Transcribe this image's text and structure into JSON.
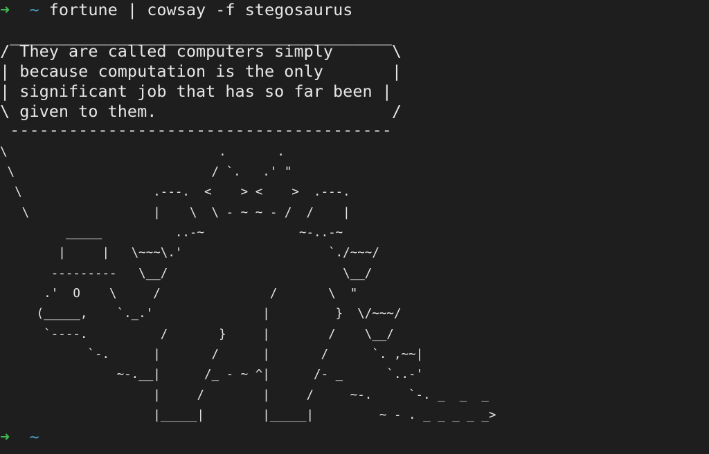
{
  "terminal": {
    "prompt_arrow": "➜",
    "prompt_dir": "~",
    "command": "fortune | cowsay -f stegosaurus",
    "bubble": [
      " _______________________________________",
      "/ They are called computers simply      \\",
      "| because computation is the only       |",
      "| significant job that has so far been |",
      "\\ given to them.                        /",
      " ---------------------------------------"
    ],
    "art": [
      "\\                             .       .",
      " \\                           / `.   .' \"",
      "  \\                  .---.  <    > <    >  .---.",
      "   \\                 |    \\  \\ - ~ ~ - /  /    |",
      "         _____          ..-~             ~-..-~",
      "        |     |   \\~~~\\.'                    `./~~~/",
      "       ---------   \\__/                        \\__/",
      "      .'  O    \\     /               /       \\  \"",
      "     (_____,    `._.'               |         }  \\/~~~/",
      "      `----.          /       }     |        /    \\__/",
      "            `-.      |       /      |       /      `. ,~~|",
      "                ~-.__|      /_ - ~ ^|      /- _      `..-'",
      "                     |     /        |     /     ~-.     `-. _  _  _",
      "                     |_____|        |_____|         ~ - . _ _ _ _ _>"
    ],
    "final_prompt_arrow": "➜",
    "final_prompt_dir": "~"
  },
  "colors": {
    "background": "#1e1e1e",
    "text": "#e6e6e6",
    "prompt_arrow": "#3fb950",
    "prompt_dir": "#4ea3c8"
  }
}
